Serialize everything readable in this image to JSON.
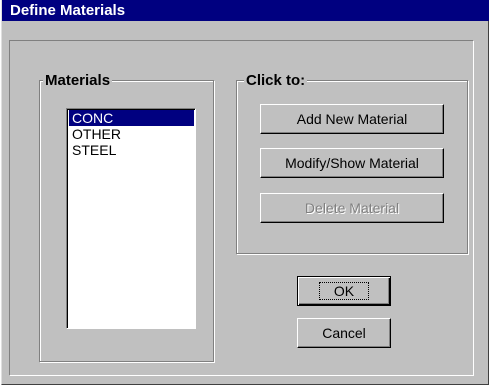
{
  "window": {
    "title": "Define Materials"
  },
  "materials_group": {
    "label": "Materials",
    "items": [
      "CONC",
      "OTHER",
      "STEEL"
    ],
    "selected_index": 0
  },
  "actions_group": {
    "label": "Click to:",
    "add_label": "Add New Material",
    "modify_label": "Modify/Show Material",
    "delete_label": "Delete Material"
  },
  "buttons": {
    "ok_label": "OK",
    "cancel_label": "Cancel"
  },
  "colors": {
    "title_bar": "#000080",
    "selection": "#000080",
    "face": "#c0c0c0"
  }
}
